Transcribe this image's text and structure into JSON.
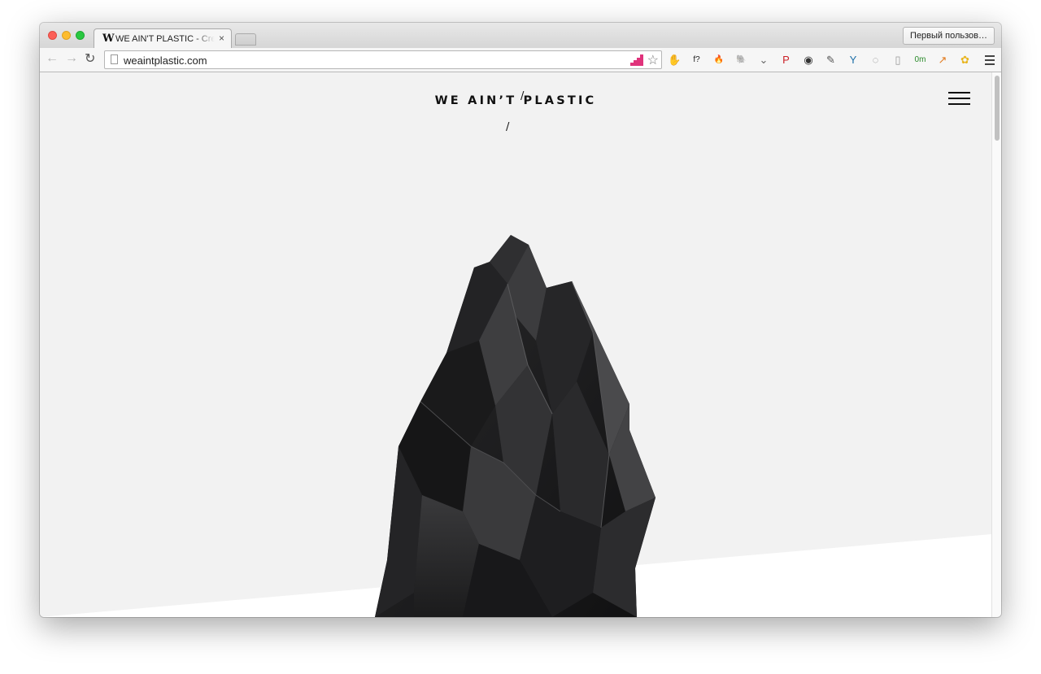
{
  "browser": {
    "tab": {
      "favicon": "W",
      "title": "WE AIN'T PLASTIC - Creative",
      "close": "×"
    },
    "profile_button": "Первый пользов…",
    "address_bar": {
      "url": "weaintplastic.com"
    },
    "extensions": [
      {
        "name": "adblock-icon",
        "glyph": "✋",
        "color": "#d9362b"
      },
      {
        "name": "whatfont-icon",
        "glyph": "f?",
        "color": "#222222"
      },
      {
        "name": "fire-icon",
        "glyph": "🔥",
        "color": "#e8661c"
      },
      {
        "name": "evernote-icon",
        "glyph": "🐘",
        "color": "#555555"
      },
      {
        "name": "pocket-icon",
        "glyph": "⌄",
        "color": "#666666"
      },
      {
        "name": "pinterest-icon",
        "glyph": "P",
        "color": "#cb2027"
      },
      {
        "name": "camera-icon",
        "glyph": "◉",
        "color": "#333333"
      },
      {
        "name": "eyedropper-icon",
        "glyph": "✎",
        "color": "#555555"
      },
      {
        "name": "filter-icon",
        "glyph": "Y",
        "color": "#1d6fa8"
      },
      {
        "name": "circle-icon",
        "glyph": "◌",
        "color": "#888888"
      },
      {
        "name": "reader-icon",
        "glyph": "▯",
        "color": "#999999"
      },
      {
        "name": "timer-icon",
        "glyph": "0m",
        "color": "#2a8a2a"
      },
      {
        "name": "chart-icon",
        "glyph": "↗",
        "color": "#e27b1f"
      },
      {
        "name": "flower-icon",
        "glyph": "✿",
        "color": "#e8b51f"
      }
    ],
    "colors": {
      "close": "#fc5f57",
      "minimize": "#fdbc2e",
      "maximize": "#29c840",
      "page_bg": "#f2f2f2",
      "rock": "#1c1c1e"
    }
  },
  "site": {
    "logo": "WE AIN’T PLASTIC",
    "slash": "/"
  }
}
